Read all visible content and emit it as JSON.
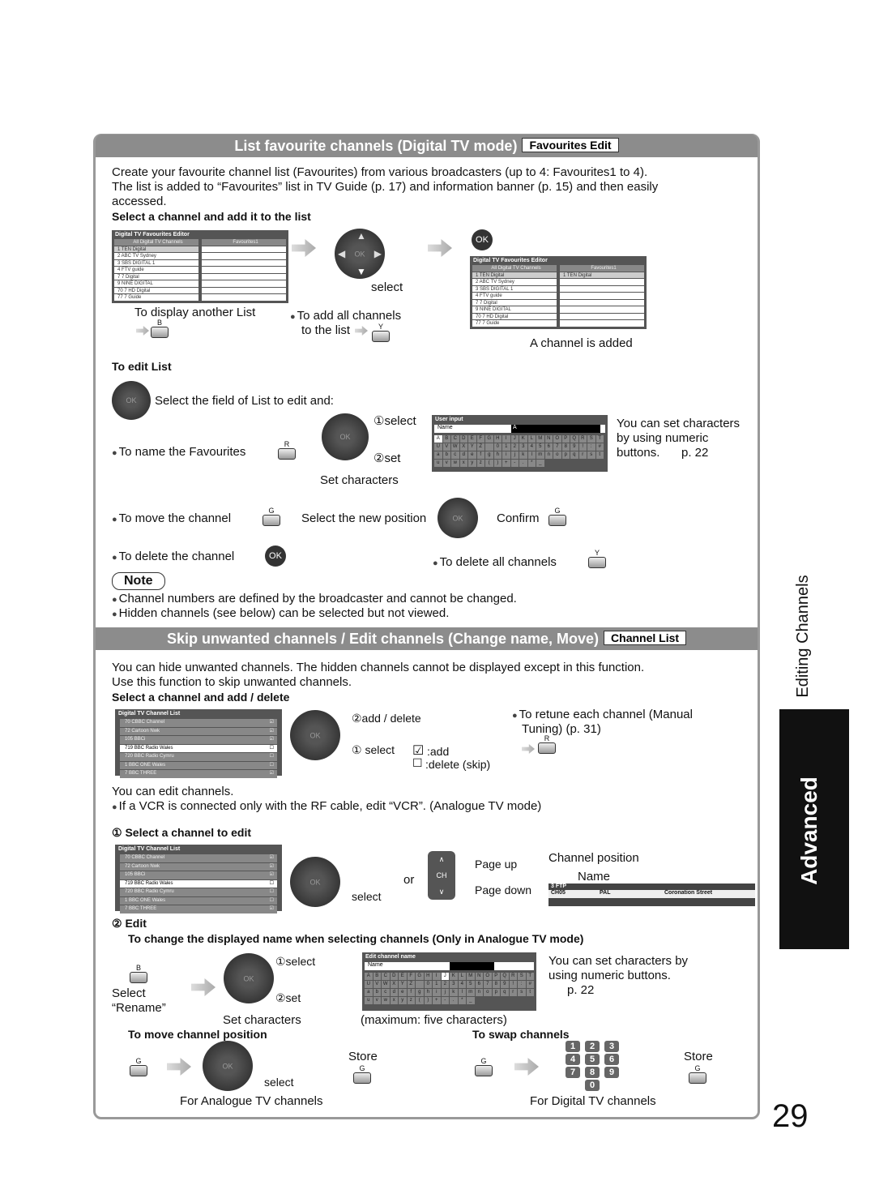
{
  "s1": {
    "title": "List favourite channels (Digital TV mode)",
    "tag": "Favourites Edit",
    "intro": [
      "Create your favourite channel list (Favourites) from various broadcasters (up to 4: Favourites1 to 4).",
      "The list is added to “Favourites” list in TV Guide (p. 17) and information banner (p. 15) and then easily",
      "accessed."
    ],
    "sub1": "Select a channel and add it to the list",
    "editor_title": "Digital TV Favourites Editor",
    "col_all": "All Digital TV Channels",
    "col_fav": "Favourites1",
    "channels": [
      "1  TEN Digital",
      "2  ABC TV Sydney",
      "3  SBS DIGITAL 1",
      "4  FTV guide",
      "7  7 Digital",
      "9  NINE DIGITAL",
      "70  7 HD Digital",
      "77  7 Guide"
    ],
    "fav_added": "1  TEN Digital",
    "select": "select",
    "ok": "OK",
    "display_other": "To display another List",
    "key_b": "B",
    "add_all_1": "To add all channels",
    "add_all_2": "to the list",
    "key_y": "Y",
    "added": "A channel is added",
    "edit_list": "To edit List",
    "select_field": "Select the field of List to edit and:",
    "name_fav": "To name the Favourites",
    "key_r": "R",
    "sel1": "①select",
    "set2": "②set",
    "set_chars": "Set characters",
    "ui_title": "User input",
    "ui_name": "Name",
    "ui_value": "A",
    "kb": [
      [
        "A",
        "B",
        "C",
        "D",
        "E",
        "F",
        "G",
        "H",
        "I",
        "J",
        "K",
        "L",
        "M",
        "N",
        "O",
        "P",
        "Q",
        "R",
        "S",
        "T"
      ],
      [
        "U",
        "V",
        "W",
        "X",
        "Y",
        "Z",
        " ",
        "0",
        "1",
        "2",
        "3",
        "4",
        "5",
        "6",
        "7",
        "8",
        "9",
        "!",
        ":",
        "#"
      ],
      [
        "a",
        "b",
        "c",
        "d",
        "e",
        "f",
        "g",
        "h",
        "i",
        "j",
        "k",
        "l",
        "m",
        "n",
        "o",
        "p",
        "q",
        "r",
        "s",
        "t"
      ],
      [
        "u",
        "v",
        "w",
        "x",
        "y",
        "z",
        "(",
        ")",
        "+",
        "-",
        ".",
        "*",
        "_"
      ]
    ],
    "numeric": [
      "You can set characters",
      "by using numeric",
      "buttons.",
      "p. 22"
    ],
    "move": "To move the channel",
    "key_g": "G",
    "new_pos": "Select the new position",
    "confirm": "Confirm",
    "del": "To delete the channel",
    "del_all": "To delete all channels",
    "note": "Note",
    "notes": [
      "Channel numbers are defined by the broadcaster and cannot be changed.",
      "Hidden channels (see below) can be selected but not viewed."
    ]
  },
  "s2": {
    "title": "Skip unwanted channels / Edit channels (Change name, Move)",
    "tag": "Channel List",
    "intro": [
      "You can hide unwanted channels. The hidden channels cannot be displayed except in this function.",
      "Use this function to skip unwanted channels."
    ],
    "sub1": "Select a channel and add / delete",
    "list_title": "Digital TV Channel List",
    "list": [
      {
        "n": "70",
        "name": "CBBC Channel",
        "m": "☑"
      },
      {
        "n": "72",
        "name": "Cartoon Nwk",
        "m": "☑"
      },
      {
        "n": "105",
        "name": "BBCi",
        "m": "☑"
      },
      {
        "n": "719",
        "name": "BBC Radio Wales",
        "m": "☐"
      },
      {
        "n": "720",
        "name": "BBC Radio Cymru",
        "m": "☐"
      },
      {
        "n": "1",
        "name": "BBC ONE Wales",
        "m": "☐"
      },
      {
        "n": "7",
        "name": "BBC THREE",
        "m": "☑"
      }
    ],
    "add_delete": "②add / delete",
    "select1": "① select",
    "add": ":add",
    "delete": ":delete (skip)",
    "retune": [
      "To retune each channel (Manual",
      "Tuning) (p. 31)"
    ],
    "key_r": "R",
    "can_edit": "You can edit channels.",
    "vcr": "If a VCR is connected only with the RF cable, edit “VCR”. (Analogue TV mode)",
    "step1": "① Select a channel to edit",
    "select": "select",
    "or": "or",
    "ch": "CH",
    "page_up": "Page up",
    "page_down": "Page down",
    "ch_pos": "Channel position",
    "name_lbl": "Name",
    "banner": {
      "top": "3 FTP",
      "ch": "CH05",
      "sys": "PAL",
      "prog": "Coronation Street"
    },
    "step2": "② Edit",
    "edit_desc": "To change the displayed name when selecting channels (Only in Analogue TV mode)",
    "key_b": "B",
    "sel_rename": [
      "Select",
      "“Rename”"
    ],
    "sel1": "①select",
    "set2": "②set",
    "set_chars": "Set characters",
    "ecn_title": "Edit channel name",
    "ecn_name": "Name",
    "max": "(maximum: five characters)",
    "numeric": [
      "You can set characters by",
      "using numeric buttons.",
      "p. 22"
    ],
    "move_pos": "To move channel position",
    "swap": "To swap channels",
    "key_g": "G",
    "store": "Store",
    "for_analogue": "For Analogue TV channels",
    "for_digital": "For Digital TV channels",
    "digits": [
      "1",
      "2",
      "3",
      "4",
      "5",
      "6",
      "7",
      "8",
      "9",
      "0"
    ]
  },
  "side": {
    "section": "Editing Channels",
    "chapter": "Advanced"
  },
  "page_number": "29"
}
